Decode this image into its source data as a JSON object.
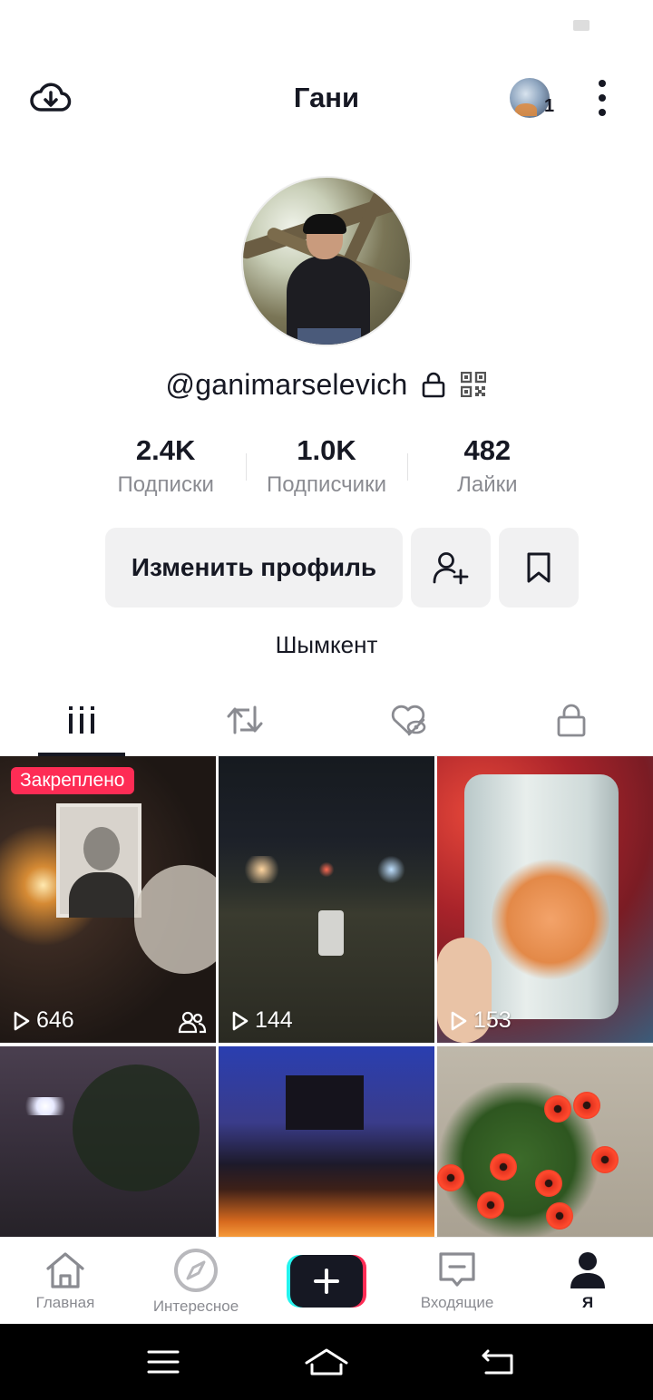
{
  "header": {
    "title": "Гани",
    "followed_badge_count": "1"
  },
  "profile": {
    "username": "@ganimarselevich",
    "city": "Шымкент"
  },
  "stats": [
    {
      "value": "2.4K",
      "label": "Подписки"
    },
    {
      "value": "1.0K",
      "label": "Подписчики"
    },
    {
      "value": "482",
      "label": "Лайки"
    }
  ],
  "actions": {
    "edit_profile": "Изменить профиль"
  },
  "tabs": [
    {
      "icon": "grid-icon",
      "active": true
    },
    {
      "icon": "repost-icon",
      "active": false
    },
    {
      "icon": "liked-hidden-icon",
      "active": false
    },
    {
      "icon": "lock-icon",
      "active": false
    }
  ],
  "videos": [
    {
      "pinned_label": "Закреплено",
      "views": "646",
      "friends_only": true
    },
    {
      "views": "144"
    },
    {
      "views": "153"
    },
    {},
    {},
    {}
  ],
  "bottom_nav": [
    {
      "label": "Главная",
      "icon": "home-icon"
    },
    {
      "label": "Интересное",
      "icon": "compass-icon"
    },
    {
      "label": "",
      "icon": "plus-icon"
    },
    {
      "label": "Входящие",
      "icon": "inbox-icon"
    },
    {
      "label": "Я",
      "icon": "profile-icon",
      "active": true
    }
  ],
  "colors": {
    "accent": "#fe2c55",
    "cyan": "#25f4ee",
    "text": "#161823",
    "muted": "#8a8b91",
    "button_bg": "#f1f1f2"
  }
}
